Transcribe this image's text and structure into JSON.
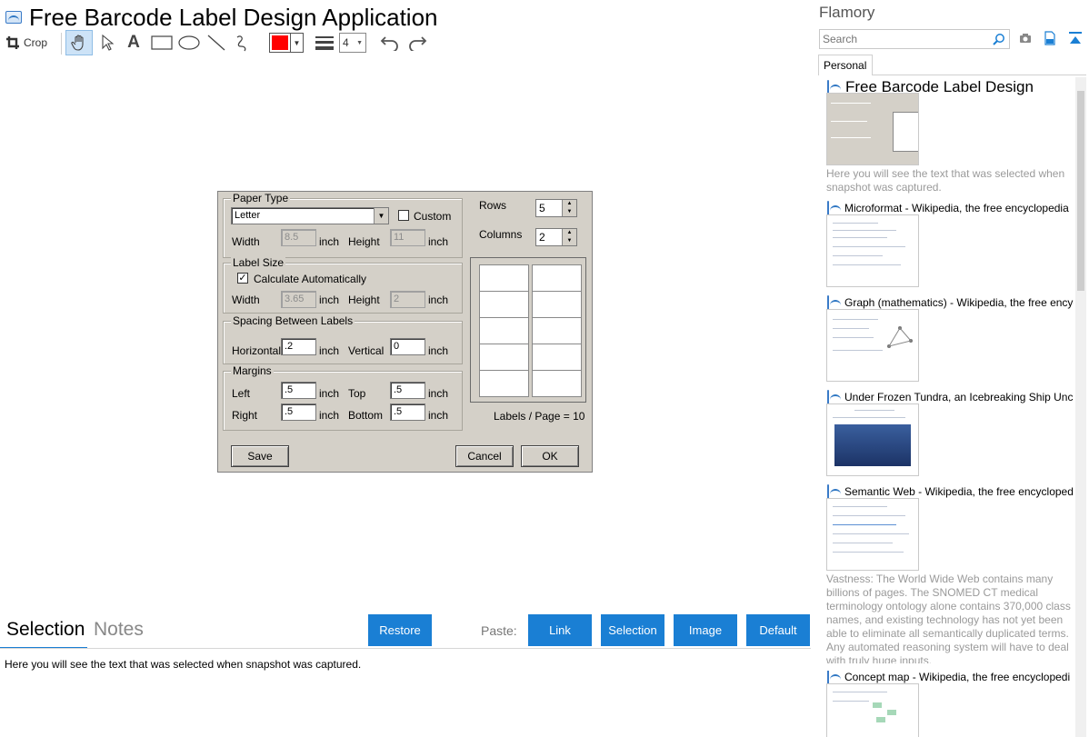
{
  "app": {
    "title": "Free Barcode Label Design Application"
  },
  "toolbar": {
    "crop_label": "Crop",
    "color": "#ff0000",
    "line_width": "4",
    "accent": "#1a7fd4"
  },
  "dialog": {
    "paper_type": {
      "title": "Paper Type",
      "paper_value": "Letter",
      "custom_label": "Custom",
      "width_label": "Width",
      "width_value": "8.5",
      "width_unit": "inch",
      "height_label": "Height",
      "height_value": "11",
      "height_unit": "inch"
    },
    "rows": {
      "label": "Rows",
      "value": "5"
    },
    "columns": {
      "label": "Columns",
      "value": "2"
    },
    "label_size": {
      "title": "Label Size",
      "calc_label": "Calculate Automatically",
      "width_label": "Width",
      "width_value": "3.65",
      "width_unit": "inch",
      "height_label": "Height",
      "height_value": "2",
      "height_unit": "inch"
    },
    "spacing": {
      "title": "Spacing Between Labels",
      "horizontal_label": "Horizontal",
      "horizontal_value": ".2",
      "horizontal_unit": "inch",
      "vertical_label": "Vertical",
      "vertical_value": "0",
      "vertical_unit": "inch"
    },
    "margins": {
      "title": "Margins",
      "left_label": "Left",
      "left_value": ".5",
      "left_unit": "inch",
      "top_label": "Top",
      "top_value": ".5",
      "top_unit": "inch",
      "right_label": "Right",
      "right_value": ".5",
      "right_unit": "inch",
      "bottom_label": "Bottom",
      "bottom_value": ".5",
      "bottom_unit": "inch"
    },
    "labels_per_page": "Labels / Page = 10",
    "save_label": "Save",
    "cancel_label": "Cancel",
    "ok_label": "OK"
  },
  "bottom": {
    "tabs": [
      "Selection",
      "Notes"
    ],
    "restore_label": "Restore",
    "paste_label": "Paste:",
    "paste_buttons": [
      "Link",
      "Selection",
      "Image",
      "Default"
    ],
    "selection_text": "Here you will see the text that was selected when snapshot was captured."
  },
  "flamory": {
    "title": "Flamory",
    "search_placeholder": "Search",
    "tab": "Personal",
    "items": [
      {
        "title": "Free Barcode Label Design",
        "note": "Here you will see the text that was selected when snapshot was captured."
      },
      {
        "title": "Microformat - Wikipedia, the free encyclopedia"
      },
      {
        "title": "Graph (mathematics) - Wikipedia, the free encyc"
      },
      {
        "title": "Under Frozen Tundra, an Icebreaking Ship Unco"
      },
      {
        "title": "Semantic Web - Wikipedia, the free encycloped",
        "note": "Vastness: The World Wide Web contains many billions of pages. The SNOMED CT medical terminology ontology alone contains 370,000 class names, and existing technology has not yet been able to eliminate all semantically duplicated terms. Any automated reasoning system will have to deal with truly huge inputs."
      },
      {
        "title": "Concept map - Wikipedia, the free encyclopedi"
      }
    ]
  }
}
